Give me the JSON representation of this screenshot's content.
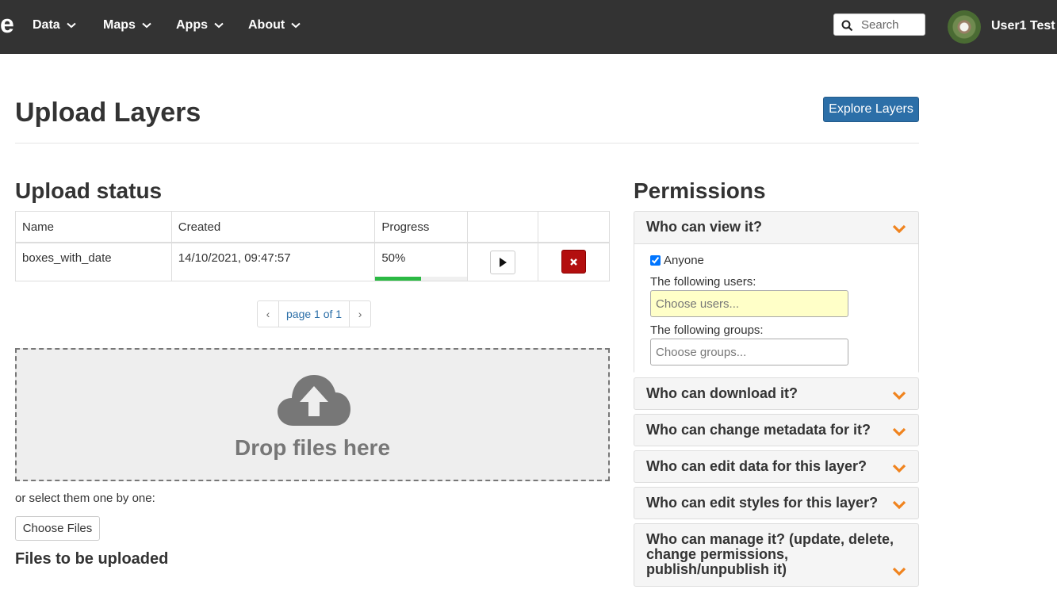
{
  "nav": {
    "brand": "e",
    "items": [
      {
        "label": "Data"
      },
      {
        "label": "Maps"
      },
      {
        "label": "Apps"
      },
      {
        "label": "About"
      }
    ],
    "search_placeholder": "Search",
    "user_name": "User1 Test"
  },
  "header": {
    "title": "Upload Layers",
    "explore_button": "Explore Layers"
  },
  "upload_status": {
    "title": "Upload status",
    "columns": [
      "Name",
      "Created",
      "Progress",
      "",
      ""
    ],
    "rows": [
      {
        "name": "boxes_with_date",
        "created": "14/10/2021, 09:47:57",
        "progress_text": "50%",
        "progress": 0.5
      }
    ],
    "pager": {
      "prev": "‹",
      "info": "page 1 of 1",
      "next": "›"
    }
  },
  "dropzone": {
    "text": "Drop files here",
    "or_text": "or select them one by one:",
    "choose_button": "Choose Files",
    "files_title": "Files to be uploaded"
  },
  "permissions": {
    "title": "Permissions",
    "view": {
      "title": "Who can view it?",
      "anyone_label": "Anyone",
      "anyone_checked": true,
      "users_label": "The following users:",
      "users_placeholder": "Choose users...",
      "groups_label": "The following groups:",
      "groups_placeholder": "Choose groups..."
    },
    "download": "Who can download it?",
    "change_metadata": "Who can change metadata for it?",
    "edit_data": "Who can edit data for this layer?",
    "edit_styles": "Who can edit styles for this layer?",
    "manage": "Who can manage it? (update, delete, change permissions, publish/unpublish it)"
  },
  "colors": {
    "navbar": "#333333",
    "primary": "#2c6fa8",
    "danger": "#b30f0f",
    "progress": "#2bb944",
    "chevron": "#f0831e"
  }
}
